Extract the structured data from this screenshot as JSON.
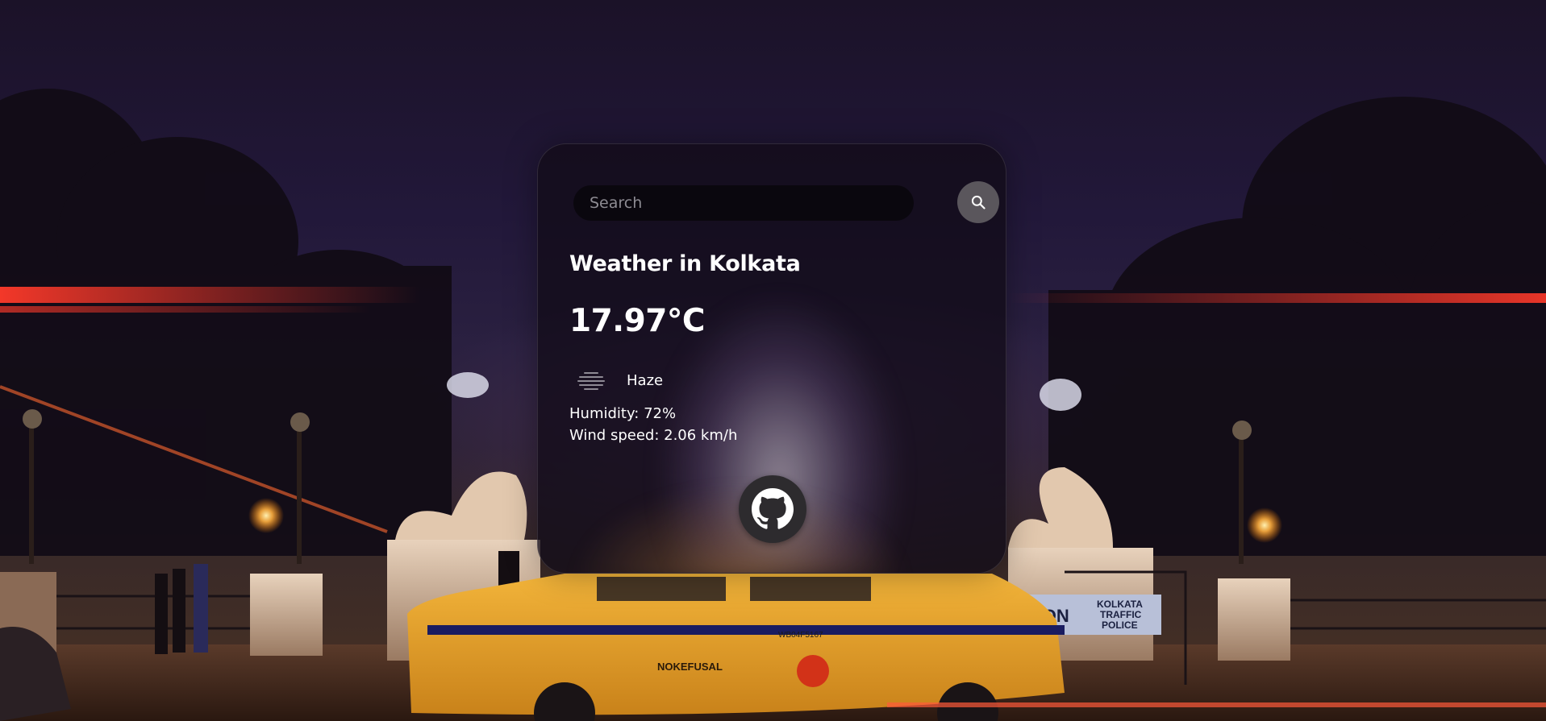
{
  "search": {
    "placeholder": "Search",
    "value": "",
    "icon": "search-icon"
  },
  "weather": {
    "title": "Weather in Kolkata",
    "temperature": "17.97°C",
    "condition_icon": "haze-icon",
    "condition": "Haze",
    "humidity": "Humidity: 72%",
    "wind": "Wind speed: 2.06 km/h"
  },
  "footer": {
    "github_icon": "github-icon"
  },
  "background": {
    "taxi_plate": "WB04F5167",
    "taxi_name": "NOKEFUSAL",
    "sign_line1": "KOLKATA",
    "sign_line2": "TRAFFIC",
    "sign_line3": "POLICE",
    "sign_left": "ATTON"
  },
  "colors": {
    "card_background": "#140c18",
    "search_field": "#08060c",
    "search_button": "#5a565c",
    "github_button": "#2d2b2e",
    "text": "#ffffff",
    "taxi_yellow": "#e8a21e"
  }
}
